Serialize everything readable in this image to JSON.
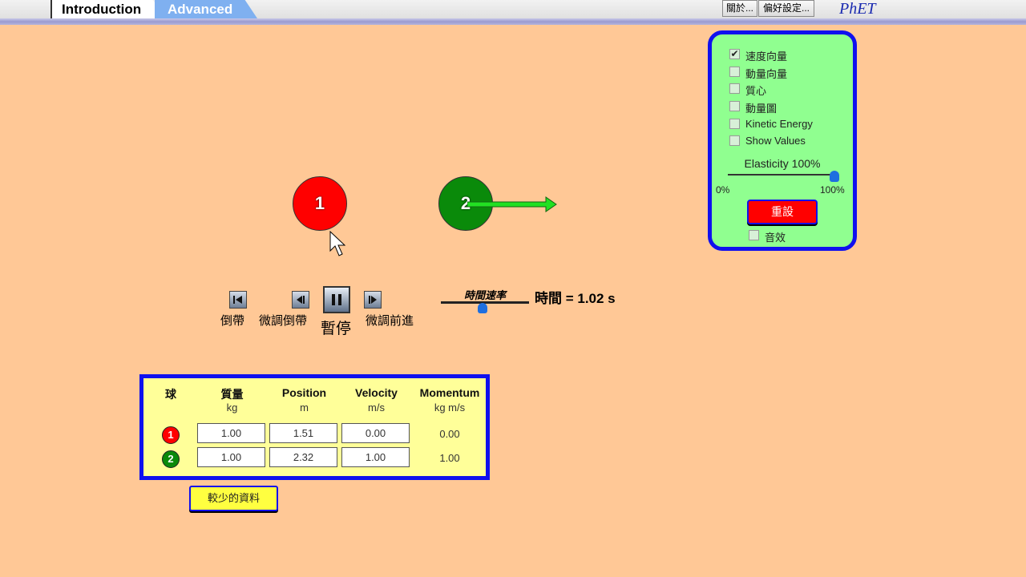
{
  "tabs": [
    {
      "label": "Introduction"
    },
    {
      "label": "Advanced"
    }
  ],
  "toolbar": {
    "about": "關於...",
    "preferences": "偏好設定...",
    "logo": "PhET"
  },
  "panel": {
    "checkboxes": [
      {
        "label": "速度向量",
        "checked": true
      },
      {
        "label": "動量向量",
        "checked": false
      },
      {
        "label": "質心",
        "checked": false
      },
      {
        "label": "動量圖",
        "checked": false
      },
      {
        "label": "Kinetic Energy",
        "checked": false
      },
      {
        "label": "Show Values",
        "checked": false
      }
    ],
    "elasticity_label": "Elasticity 100%",
    "elasticity_min": "0%",
    "elasticity_max": "100%",
    "elasticity_value": 1.0,
    "reset_label": "重設",
    "sound_label": "音效",
    "sound_checked": false
  },
  "balls": [
    {
      "label": "1",
      "color": "#FF0000"
    },
    {
      "label": "2",
      "color": "#0A8A0A"
    }
  ],
  "playback": {
    "rewind": "倒帶",
    "step_back": "微調倒帶",
    "pause": "暫停",
    "step_forward": "微調前進",
    "speed_title": "時間速率",
    "speed_value": 0.5,
    "time_readout": "時間 = 1.02 s"
  },
  "table": {
    "headers": [
      {
        "name": "球",
        "unit": ""
      },
      {
        "name": "質量",
        "unit": "kg"
      },
      {
        "name": "Position",
        "unit": "m"
      },
      {
        "name": "Velocity",
        "unit": "m/s"
      },
      {
        "name": "Momentum",
        "unit": "kg m/s"
      }
    ],
    "rows": [
      {
        "ball": "1",
        "mass": "1.00",
        "position": "1.51",
        "velocity": "0.00",
        "momentum": "0.00"
      },
      {
        "ball": "2",
        "mass": "1.00",
        "position": "2.32",
        "velocity": "1.00",
        "momentum": "1.00"
      }
    ],
    "less_data_label": "較少的資料"
  },
  "colors": {
    "background": "#FFC896",
    "panel": "#90FF90",
    "panel_border": "#1010EE",
    "table": "#FFFF99"
  }
}
